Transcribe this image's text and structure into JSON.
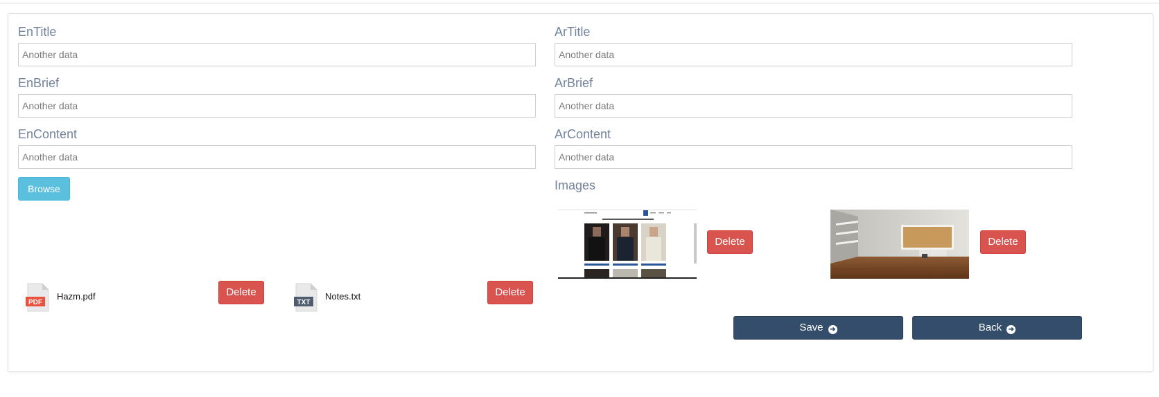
{
  "form": {
    "left": {
      "en_title": {
        "label": "EnTitle",
        "placeholder": "Another data"
      },
      "en_brief": {
        "label": "EnBrief",
        "placeholder": "Another data"
      },
      "en_content": {
        "label": "EnContent",
        "placeholder": "Another data"
      }
    },
    "right": {
      "ar_title": {
        "label": "ArTitle",
        "placeholder": "Another data"
      },
      "ar_brief": {
        "label": "ArBrief",
        "placeholder": "Another data"
      },
      "ar_content": {
        "label": "ArContent",
        "placeholder": "Another data"
      }
    }
  },
  "browse_label": "Browse",
  "files": [
    {
      "name": "Hazm.pdf",
      "type_badge": "PDF",
      "badge_color": "#e8523f",
      "icon": "pdf-file-icon",
      "delete_label": "Delete"
    },
    {
      "name": "Notes.txt",
      "type_badge": "TXT",
      "badge_color": "#4f5d6e",
      "icon": "txt-file-icon",
      "delete_label": "Delete"
    }
  ],
  "images": {
    "label": "Images",
    "items": [
      {
        "alt": "website screenshot",
        "delete_label": "Delete"
      },
      {
        "alt": "empty room with shelves",
        "delete_label": "Delete"
      }
    ]
  },
  "actions": {
    "save_label": "Save",
    "back_label": "Back"
  },
  "colors": {
    "label": "#72839b",
    "browse": "#5bc0de",
    "delete": "#d9534f",
    "primary_dark": "#344d6a"
  }
}
